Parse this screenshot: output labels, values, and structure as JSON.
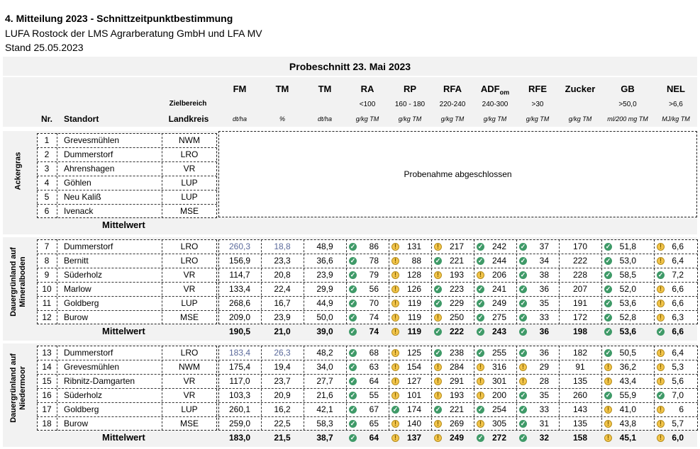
{
  "header": {
    "title": "4. Mitteilung 2023 - Schnittzeitpunktbestimmung",
    "org": "LUFA Rostock der LMS Agrarberatung GmbH und LFA MV",
    "stand": "Stand 25.05.2023"
  },
  "table_title": "Probeschnitt 23. Mai 2023",
  "columns": {
    "nr": "Nr.",
    "standort": "Standort",
    "zielbereich": "Zielbereich",
    "landkreis": "Landkreis",
    "metrics": [
      {
        "name": "FM",
        "range": "",
        "unit": "dt/ha"
      },
      {
        "name": "TM",
        "range": "",
        "unit": "%"
      },
      {
        "name": "TM",
        "range": "",
        "unit": "dt/ha"
      },
      {
        "name": "RA",
        "range": "<100",
        "unit": "g/kg TM"
      },
      {
        "name": "RP",
        "range": "160 - 180",
        "unit": "g/kg TM"
      },
      {
        "name": "RFA",
        "range": "220-240",
        "unit": "g/kg TM"
      },
      {
        "name": "ADF",
        "sub": "om",
        "range": "240-300",
        "unit": "g/kg TM"
      },
      {
        "name": "RFE",
        "range": ">30",
        "unit": "g/kg TM"
      },
      {
        "name": "Zucker",
        "range": "",
        "unit": "g/kg TM"
      },
      {
        "name": "GB",
        "range": ">50,0",
        "unit": "ml/200 mg TM"
      },
      {
        "name": "NEL",
        "range": ">6,6",
        "unit": "MJ/kg TM"
      }
    ]
  },
  "mittelwert_label": "Mittelwert",
  "groups": [
    {
      "label_lines": [
        "Ackergras"
      ],
      "closed_text": "Probenahme abgeschlossen",
      "rows": [
        {
          "nr": "1",
          "standort": "Grevesmühlen",
          "landkreis": "NWM"
        },
        {
          "nr": "2",
          "standort": "Dummerstorf",
          "landkreis": "LRO"
        },
        {
          "nr": "3",
          "standort": "Ahrenshagen",
          "landkreis": "VR"
        },
        {
          "nr": "4",
          "standort": "Göhlen",
          "landkreis": "LUP"
        },
        {
          "nr": "5",
          "standort": "Neu Kaliß",
          "landkreis": "LUP"
        },
        {
          "nr": "6",
          "standort": "Ivenack",
          "landkreis": "MSE"
        }
      ]
    },
    {
      "label_lines": [
        "Dauergrünland auf",
        "Mineralboden"
      ],
      "rows": [
        {
          "nr": "7",
          "standort": "Dummerstorf",
          "landkreis": "LRO",
          "fm": "260,3",
          "tm_pct": "18,8",
          "tm": "48,9",
          "blue": true,
          "ra": [
            "86",
            "good"
          ],
          "rp": [
            "131",
            "warn"
          ],
          "rfa": [
            "217",
            "warn"
          ],
          "adf": [
            "242",
            "good"
          ],
          "rfe": [
            "37",
            "good"
          ],
          "zucker": "170",
          "gb": [
            "51,8",
            "good"
          ],
          "nel": [
            "6,6",
            "warn"
          ]
        },
        {
          "nr": "8",
          "standort": "Bernitt",
          "landkreis": "LRO",
          "fm": "156,9",
          "tm_pct": "23,3",
          "tm": "36,6",
          "ra": [
            "78",
            "good"
          ],
          "rp": [
            "88",
            "warn"
          ],
          "rfa": [
            "221",
            "good"
          ],
          "adf": [
            "244",
            "good"
          ],
          "rfe": [
            "34",
            "good"
          ],
          "zucker": "222",
          "gb": [
            "53,0",
            "good"
          ],
          "nel": [
            "6,4",
            "warn"
          ]
        },
        {
          "nr": "9",
          "standort": "Süderholz",
          "landkreis": "VR",
          "fm": "114,7",
          "tm_pct": "20,8",
          "tm": "23,9",
          "ra": [
            "79",
            "good"
          ],
          "rp": [
            "128",
            "warn"
          ],
          "rfa": [
            "193",
            "warn"
          ],
          "adf": [
            "206",
            "warn"
          ],
          "rfe": [
            "38",
            "good"
          ],
          "zucker": "228",
          "gb": [
            "58,5",
            "good"
          ],
          "nel": [
            "7,2",
            "good"
          ]
        },
        {
          "nr": "10",
          "standort": "Marlow",
          "landkreis": "VR",
          "fm": "133,4",
          "tm_pct": "22,4",
          "tm": "29,9",
          "ra": [
            "56",
            "good"
          ],
          "rp": [
            "126",
            "warn"
          ],
          "rfa": [
            "223",
            "good"
          ],
          "adf": [
            "241",
            "good"
          ],
          "rfe": [
            "36",
            "good"
          ],
          "zucker": "207",
          "gb": [
            "52,0",
            "good"
          ],
          "nel": [
            "6,6",
            "warn"
          ]
        },
        {
          "nr": "11",
          "standort": "Goldberg",
          "landkreis": "LUP",
          "fm": "268,6",
          "tm_pct": "16,7",
          "tm": "44,9",
          "ra": [
            "70",
            "good"
          ],
          "rp": [
            "119",
            "warn"
          ],
          "rfa": [
            "229",
            "good"
          ],
          "adf": [
            "249",
            "good"
          ],
          "rfe": [
            "35",
            "good"
          ],
          "zucker": "191",
          "gb": [
            "53,6",
            "good"
          ],
          "nel": [
            "6,6",
            "warn"
          ]
        },
        {
          "nr": "12",
          "standort": "Burow",
          "landkreis": "MSE",
          "fm": "209,0",
          "tm_pct": "23,9",
          "tm": "50,0",
          "ra": [
            "74",
            "good"
          ],
          "rp": [
            "119",
            "warn"
          ],
          "rfa": [
            "250",
            "warn"
          ],
          "adf": [
            "275",
            "good"
          ],
          "rfe": [
            "33",
            "good"
          ],
          "zucker": "172",
          "gb": [
            "52,8",
            "good"
          ],
          "nel": [
            "6,3",
            "warn"
          ]
        }
      ],
      "mean": {
        "fm": "190,5",
        "tm_pct": "21,0",
        "tm": "39,0",
        "ra": [
          "74",
          "good"
        ],
        "rp": [
          "119",
          "warn"
        ],
        "rfa": [
          "222",
          "good"
        ],
        "adf": [
          "243",
          "good"
        ],
        "rfe": [
          "36",
          "good"
        ],
        "zucker": "198",
        "gb": [
          "53,6",
          "good"
        ],
        "nel": [
          "6,6",
          "good"
        ]
      }
    },
    {
      "label_lines": [
        "Dauergrünland auf",
        "Niedermoor"
      ],
      "rows": [
        {
          "nr": "13",
          "standort": "Dummerstorf",
          "landkreis": "LRO",
          "fm": "183,4",
          "tm_pct": "26,3",
          "tm": "48,2",
          "blue": true,
          "ra": [
            "68",
            "good"
          ],
          "rp": [
            "125",
            "warn"
          ],
          "rfa": [
            "238",
            "good"
          ],
          "adf": [
            "255",
            "good"
          ],
          "rfe": [
            "36",
            "good"
          ],
          "zucker": "182",
          "gb": [
            "50,5",
            "good"
          ],
          "nel": [
            "6,4",
            "warn"
          ]
        },
        {
          "nr": "14",
          "standort": "Grevesmühlen",
          "landkreis": "NWM",
          "fm": "175,4",
          "tm_pct": "19,4",
          "tm": "34,0",
          "ra": [
            "63",
            "good"
          ],
          "rp": [
            "154",
            "warn"
          ],
          "rfa": [
            "284",
            "warn"
          ],
          "adf": [
            "316",
            "warn"
          ],
          "rfe": [
            "29",
            "warn"
          ],
          "zucker": "91",
          "gb": [
            "36,2",
            "warn"
          ],
          "nel": [
            "5,3",
            "warn"
          ]
        },
        {
          "nr": "15",
          "standort": "Ribnitz-Damgarten",
          "landkreis": "VR",
          "fm": "117,0",
          "tm_pct": "23,7",
          "tm": "27,7",
          "ra": [
            "64",
            "good"
          ],
          "rp": [
            "127",
            "warn"
          ],
          "rfa": [
            "291",
            "warn"
          ],
          "adf": [
            "301",
            "warn"
          ],
          "rfe": [
            "28",
            "warn"
          ],
          "zucker": "135",
          "gb": [
            "43,4",
            "warn"
          ],
          "nel": [
            "5,6",
            "warn"
          ]
        },
        {
          "nr": "16",
          "standort": "Süderholz",
          "landkreis": "VR",
          "fm": "103,3",
          "tm_pct": "20,9",
          "tm": "21,6",
          "ra": [
            "55",
            "good"
          ],
          "rp": [
            "101",
            "warn"
          ],
          "rfa": [
            "193",
            "warn"
          ],
          "adf": [
            "200",
            "warn"
          ],
          "rfe": [
            "35",
            "good"
          ],
          "zucker": "260",
          "gb": [
            "55,9",
            "good"
          ],
          "nel": [
            "7,0",
            "good"
          ]
        },
        {
          "nr": "17",
          "standort": "Goldberg",
          "landkreis": "LUP",
          "fm": "260,1",
          "tm_pct": "16,2",
          "tm": "42,1",
          "ra": [
            "67",
            "good"
          ],
          "rp": [
            "174",
            "good"
          ],
          "rfa": [
            "221",
            "good"
          ],
          "adf": [
            "254",
            "good"
          ],
          "rfe": [
            "33",
            "good"
          ],
          "zucker": "143",
          "gb": [
            "41,0",
            "warn"
          ],
          "nel": [
            "6",
            "warn"
          ]
        },
        {
          "nr": "18",
          "standort": "Burow",
          "landkreis": "MSE",
          "fm": "259,0",
          "tm_pct": "22,5",
          "tm": "58,3",
          "ra": [
            "65",
            "good"
          ],
          "rp": [
            "140",
            "warn"
          ],
          "rfa": [
            "269",
            "warn"
          ],
          "adf": [
            "305",
            "warn"
          ],
          "rfe": [
            "31",
            "good"
          ],
          "zucker": "135",
          "gb": [
            "43,8",
            "warn"
          ],
          "nel": [
            "5,7",
            "warn"
          ]
        }
      ],
      "mean": {
        "fm": "183,0",
        "tm_pct": "21,5",
        "tm": "38,7",
        "ra": [
          "64",
          "good"
        ],
        "rp": [
          "137",
          "warn"
        ],
        "rfa": [
          "249",
          "warn"
        ],
        "adf": [
          "272",
          "good"
        ],
        "rfe": [
          "32",
          "good"
        ],
        "zucker": "158",
        "gb": [
          "45,1",
          "warn"
        ],
        "nel": [
          "6,0",
          "warn"
        ]
      }
    }
  ],
  "colors": {
    "good": "#3f9a68",
    "warn": "#f3c54b",
    "band": "#f2f2f2",
    "highlight_text": "#5b6a9b"
  }
}
